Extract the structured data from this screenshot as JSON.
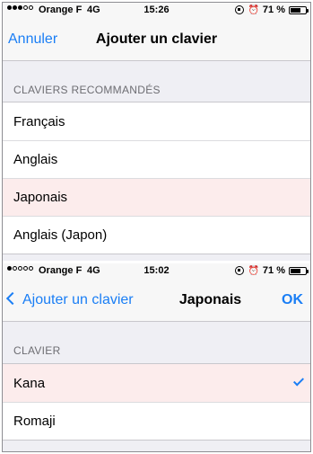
{
  "screen1": {
    "status": {
      "carrier": "Orange F",
      "network": "4G",
      "time": "15:26",
      "battery": "71 %",
      "battery_fraction": 0.71
    },
    "nav": {
      "left": "Annuler",
      "title": "Ajouter un clavier"
    },
    "section": "CLAVIERS RECOMMANDÉS",
    "items": [
      {
        "label": "Français"
      },
      {
        "label": "Anglais"
      },
      {
        "label": "Japonais"
      },
      {
        "label": "Anglais (Japon)"
      }
    ]
  },
  "screen2": {
    "status": {
      "carrier": "Orange F",
      "network": "4G",
      "time": "15:02",
      "battery": "71 %",
      "battery_fraction": 0.71
    },
    "nav": {
      "back": "Ajouter un clavier",
      "title": "Japonais",
      "right": "OK"
    },
    "section": "CLAVIER",
    "items": [
      {
        "label": "Kana",
        "checked": true
      },
      {
        "label": "Romaji"
      }
    ]
  }
}
